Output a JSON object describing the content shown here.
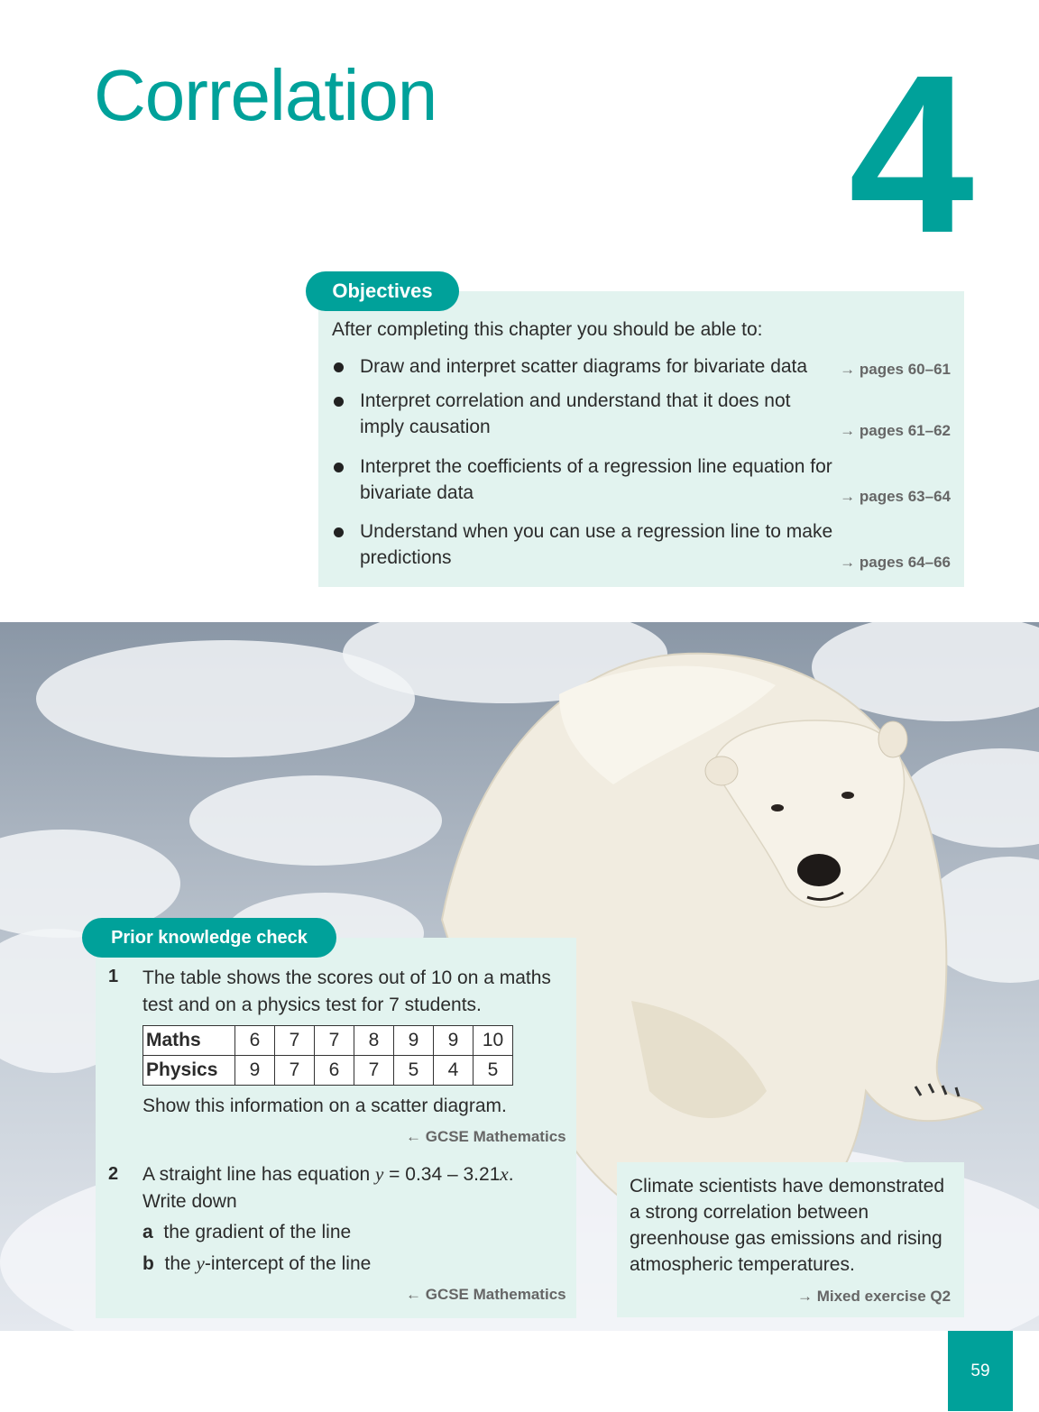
{
  "header": {
    "title": "Correlation",
    "chapter_number": "4"
  },
  "objectives": {
    "tab_label": "Objectives",
    "intro": "After completing this chapter you should be able to:",
    "items": [
      {
        "text": "Draw and interpret scatter diagrams for bivariate data",
        "ref": "→ pages 60–61"
      },
      {
        "text": "Interpret correlation and understand that it does not imply causation",
        "ref": "→ pages 61–62"
      },
      {
        "text": "Interpret the coefficients of a regression line equation for bivariate data",
        "ref": "→ pages 63–64"
      },
      {
        "text": "Understand when you can use a regression line to make predictions",
        "ref": "→ pages 64–66"
      }
    ]
  },
  "prior_knowledge": {
    "tab_label": "Prior knowledge check",
    "q1": {
      "number": "1",
      "text": "The table shows the scores out of 10 on a maths test and on a physics test for 7 students.",
      "table": {
        "rows": [
          {
            "label": "Maths",
            "values": [
              "6",
              "7",
              "7",
              "8",
              "9",
              "9",
              "10"
            ]
          },
          {
            "label": "Physics",
            "values": [
              "9",
              "7",
              "6",
              "7",
              "5",
              "4",
              "5"
            ]
          }
        ]
      },
      "instruction": "Show this information on a scatter diagram.",
      "ref": "← GCSE Mathematics"
    },
    "q2": {
      "number": "2",
      "text_before": "A straight line has equation ",
      "var_y": "y",
      "text_mid": " = 0.34 – 3.21",
      "var_x": "x",
      "text_after": ".",
      "line2": "Write down",
      "part_a_label": "a",
      "part_a_text": "the gradient of the line",
      "part_b_label": "b",
      "part_b_text_before": "the ",
      "part_b_var": "y",
      "part_b_text_after": "-intercept of the line",
      "ref": "← GCSE Mathematics"
    }
  },
  "climate": {
    "text": "Climate scientists have demonstrated a strong correlation between greenhouse gas emissions and rising atmospheric temperatures.",
    "ref": "→ Mixed exercise Q2"
  },
  "page_number": "59",
  "colors": {
    "accent": "#00a19a",
    "box_background": "#e2f3ef"
  }
}
